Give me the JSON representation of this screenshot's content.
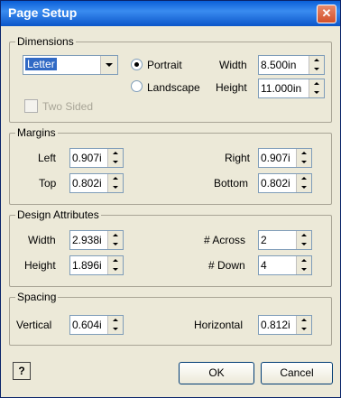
{
  "window": {
    "title": "Page Setup"
  },
  "dimensions": {
    "legend": "Dimensions",
    "paper_size": "Letter",
    "portrait_label": "Portrait",
    "landscape_label": "Landscape",
    "orientation_selected": "Portrait",
    "width_label": "Width",
    "width_value": "8.500in",
    "height_label": "Height",
    "height_value": "11.000in",
    "two_sided_label": "Two Sided"
  },
  "margins": {
    "legend": "Margins",
    "left_label": "Left",
    "left_value": "0.907i",
    "right_label": "Right",
    "right_value": "0.907i",
    "top_label": "Top",
    "top_value": "0.802i",
    "bottom_label": "Bottom",
    "bottom_value": "0.802i"
  },
  "design": {
    "legend": "Design Attributes",
    "width_label": "Width",
    "width_value": "2.938i",
    "across_label": "# Across",
    "across_value": "2",
    "height_label": "Height",
    "height_value": "1.896i",
    "down_label": "# Down",
    "down_value": "4"
  },
  "spacing": {
    "legend": "Spacing",
    "vertical_label": "Vertical",
    "vertical_value": "0.604i",
    "horizontal_label": "Horizontal",
    "horizontal_value": "0.812i"
  },
  "buttons": {
    "help_label": "?",
    "ok_label": "OK",
    "cancel_label": "Cancel"
  },
  "icons": {
    "close": "close-icon",
    "help": "help-icon"
  },
  "colors": {
    "titlebar": "#0a5fd8",
    "dialog_bg": "#ece9d8",
    "selection": "#316ac5",
    "close": "#d3502a"
  }
}
